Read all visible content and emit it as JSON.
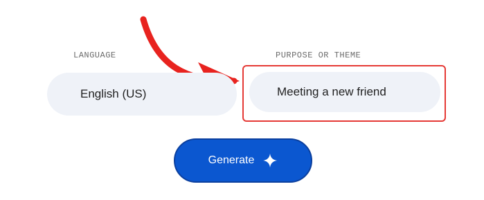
{
  "form": {
    "language": {
      "label": "LANGUAGE",
      "value": "English (US)"
    },
    "purpose": {
      "label": "PURPOSE OR THEME",
      "value": "Meeting a new friend"
    },
    "generate_button": {
      "label": "Generate",
      "icon": "sparkle-icon"
    }
  },
  "annotation": {
    "arrow_color": "#e8231f",
    "highlight_color": "#e53935"
  },
  "colors": {
    "field_background": "#eff2f8",
    "button_background": "#0b57d0"
  }
}
